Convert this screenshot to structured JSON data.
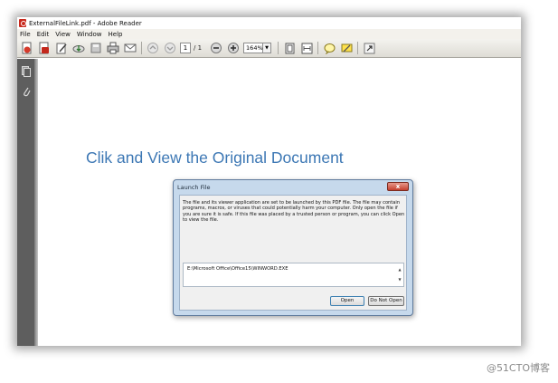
{
  "window": {
    "title": "ExternalFileLink.pdf - Adobe Reader"
  },
  "menubar": {
    "items": [
      "File",
      "Edit",
      "View",
      "Window",
      "Help"
    ]
  },
  "toolbar": {
    "icons": [
      "create-pdf-icon",
      "acrobat-icon",
      "edit-icon",
      "cloud-icon",
      "save-icon",
      "print-icon",
      "email-icon"
    ],
    "page_current": "1",
    "page_total": "/ 1",
    "zoom": "164%"
  },
  "document": {
    "link_text": "Clik and View the Original Document"
  },
  "dialog": {
    "title": "Launch File",
    "close_label": "x",
    "message": "The file and its viewer application are set to be launched by this PDF file. The file may contain programs, macros, or viruses that could potentially harm your computer. Only open the file if you are sure it is safe. If this file was placed by a trusted person or program, you can click Open to view the file.",
    "path": "E:\\Microsoft Office\\Office15\\WINWORD.EXE",
    "open_label": "Open",
    "do_not_open_label": "Do Not Open"
  },
  "watermark": "@51CTO博客",
  "colors": {
    "link": "#3c77b4",
    "dialog_frame": "#c6d9ec",
    "sidebar": "#5e5e5e"
  }
}
